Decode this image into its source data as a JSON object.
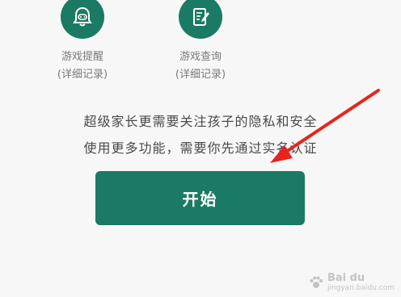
{
  "features": [
    {
      "icon": "gamepad-bell-icon",
      "title": "游戏提醒",
      "subtitle": "(详细记录)"
    },
    {
      "icon": "notepad-edit-icon",
      "title": "游戏查询",
      "subtitle": "(详细记录)"
    }
  ],
  "message": {
    "line1": "超级家长更需要关注孩子的隐私和安全",
    "line2": "使用更多功能，需要你先通过实名认证"
  },
  "start_button": {
    "label": "开始"
  },
  "watermark": {
    "text": "Bai du",
    "sub": "jingyan.baidu.com"
  },
  "colors": {
    "accent": "#1b7a63",
    "arrow": "#e8231f",
    "background": "#f7f7f7"
  }
}
